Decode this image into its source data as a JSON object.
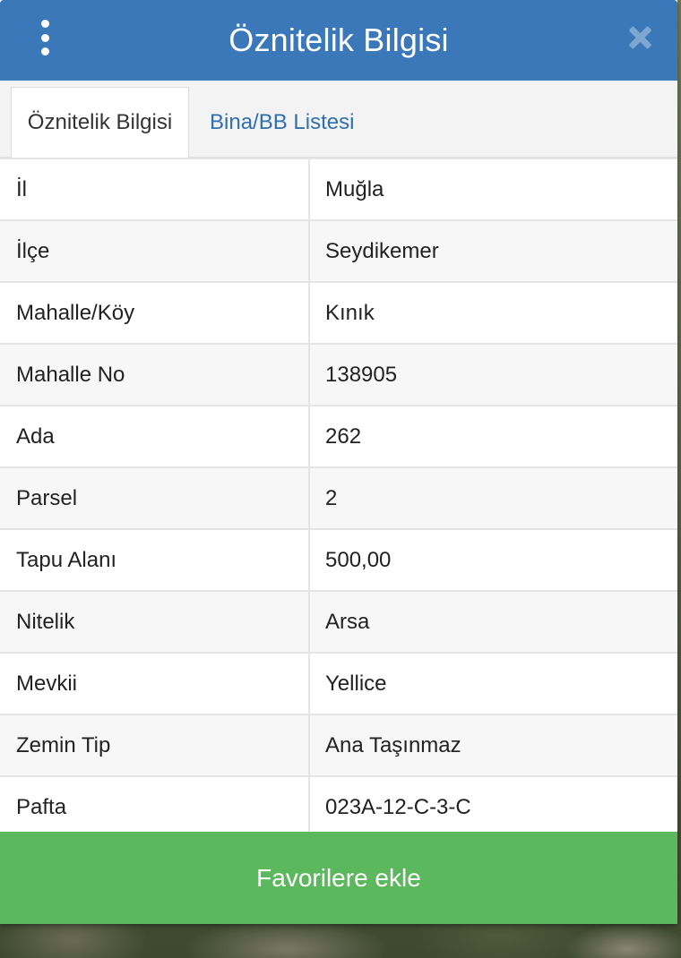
{
  "header": {
    "title": "Öznitelik Bilgisi"
  },
  "tabs": [
    {
      "label": "Öznitelik Bilgisi",
      "active": true
    },
    {
      "label": "Bina/BB Listesi",
      "active": false
    }
  ],
  "attributes": [
    {
      "key": "İl",
      "value": "Muğla"
    },
    {
      "key": "İlçe",
      "value": "Seydikemer"
    },
    {
      "key": "Mahalle/Köy",
      "value": "Kınık"
    },
    {
      "key": "Mahalle No",
      "value": "138905"
    },
    {
      "key": "Ada",
      "value": "262"
    },
    {
      "key": "Parsel",
      "value": "2"
    },
    {
      "key": "Tapu Alanı",
      "value": "500,00"
    },
    {
      "key": "Nitelik",
      "value": "Arsa"
    },
    {
      "key": "Mevkii",
      "value": "Yellice"
    },
    {
      "key": "Zemin Tip",
      "value": "Ana Taşınmaz"
    },
    {
      "key": "Pafta",
      "value": "023A-12-C-3-C"
    }
  ],
  "footer": {
    "button_label": "Favorilere ekle"
  },
  "colors": {
    "header": "#3a78b9",
    "favorite_button": "#5cb85c",
    "tab_link": "#2f6fae"
  },
  "icons": {
    "menu": "vertical-dots-icon",
    "close": "close-icon"
  }
}
